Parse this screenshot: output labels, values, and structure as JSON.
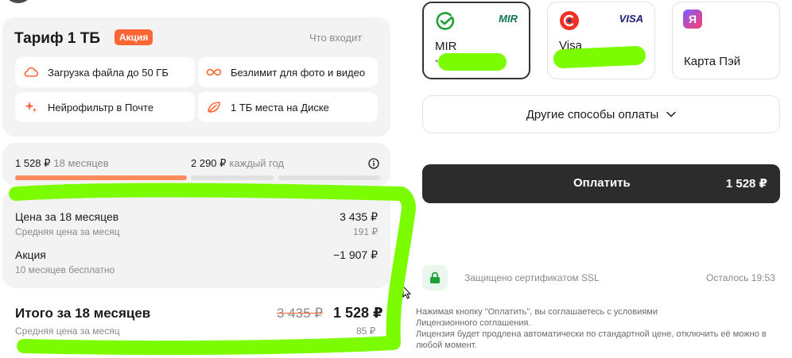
{
  "tariff": {
    "title": "Тариф 1 ТБ",
    "badge": "Акция",
    "whats_included": "Что входит",
    "features": [
      {
        "icon": "cloud-icon",
        "label": "Загрузка файла до 50 ГБ"
      },
      {
        "icon": "infinity-icon",
        "label": "Безлимит для фото и видео"
      },
      {
        "icon": "sparkles-icon",
        "label": "Нейрофильтр в Почте"
      },
      {
        "icon": "disk-leaf-icon",
        "label": "1 ТБ места на Диске"
      }
    ],
    "accent_color": "#ff6633"
  },
  "periods": [
    {
      "price": "1 528 ₽",
      "period": "18 месяцев",
      "selected": true
    },
    {
      "price": "2 290 ₽",
      "period": "каждый год",
      "selected": false
    }
  ],
  "breakdown": {
    "price_label": "Цена за 18 месяцев",
    "price_value": "3 435 ₽",
    "avg_label": "Средняя цена за месяц",
    "avg_value": "191 ₽",
    "promo_label": "Акция",
    "promo_sub": "10 месяцев бесплатно",
    "promo_value": "−1 907 ₽"
  },
  "total": {
    "label": "Итого за 18 месяцев",
    "old_price": "3 435 ₽",
    "new_price": "1 528 ₽",
    "avg_label": "Средняя цена за месяц",
    "avg_value": "85 ₽"
  },
  "payment": {
    "cards": [
      {
        "name": "MIR",
        "mask": "••",
        "brand": "MIR",
        "selected": true
      },
      {
        "name": "Visa",
        "mask": "",
        "brand": "VISA",
        "selected": false
      },
      {
        "name": "Карта Пэй",
        "mask": "",
        "brand": "Я",
        "selected": false
      }
    ],
    "other_methods": "Другие способы оплаты",
    "pay_label": "Оплатить",
    "pay_amount": "1 528 ₽"
  },
  "security": {
    "ssl_text": "Защищено сертификатом SSL",
    "remaining": "Осталось 19:53"
  },
  "legal": {
    "line1": "Нажимая кнопку \"Оплатить\", вы соглашаетесь с условиями",
    "link": "Лицензионного соглашения.",
    "line2": "Лицензия будет продлена автоматически по стандартной цене, отключить её можно в любой момент."
  }
}
